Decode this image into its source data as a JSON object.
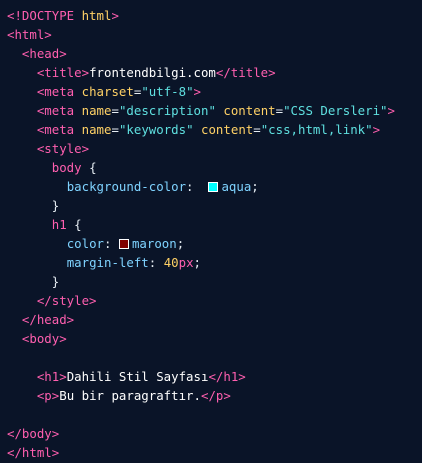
{
  "code": {
    "doctype": "<!DOCTYPE",
    "doctype_name": " html",
    "doctype_close": ">",
    "html_open": "<html>",
    "head_open": "<head>",
    "title_open": "<title>",
    "title_text": "frontendbilgi.com",
    "title_close": "</title>",
    "meta_tag": "<meta",
    "charset_attr": "charset",
    "charset_val": "\"utf-8\"",
    "name_attr": "name",
    "content_attr": "content",
    "desc_name_val": "\"description\"",
    "desc_content_val": "\"CSS Dersleri\"",
    "kw_name_val": "\"keywords\"",
    "kw_content_val": "\"css,html,link\"",
    "close_angle": ">",
    "style_open": "<style>",
    "body_selector": "body",
    "brace_open": "{",
    "bg_prop": "background-color",
    "colon": ":",
    "bg_value": "aqua",
    "semicolon": ";",
    "brace_close": "}",
    "h1_selector": "h1",
    "color_prop": "color",
    "color_value": "maroon",
    "margin_prop": "margin-left",
    "margin_num": "40",
    "margin_unit": "px",
    "style_close": "</style>",
    "head_close": "</head>",
    "body_open": "<body>",
    "h1_open": "<h1>",
    "h1_text": "Dahili Stil Sayfası",
    "h1_close": "</h1>",
    "p_open": "<p>",
    "p_text": "Bu bir paragraftır.",
    "p_close": "</p>",
    "body_close": "</body>",
    "html_close": "</html>"
  },
  "colors": {
    "aqua_swatch": "#00ffff",
    "maroon_swatch": "#800000"
  }
}
